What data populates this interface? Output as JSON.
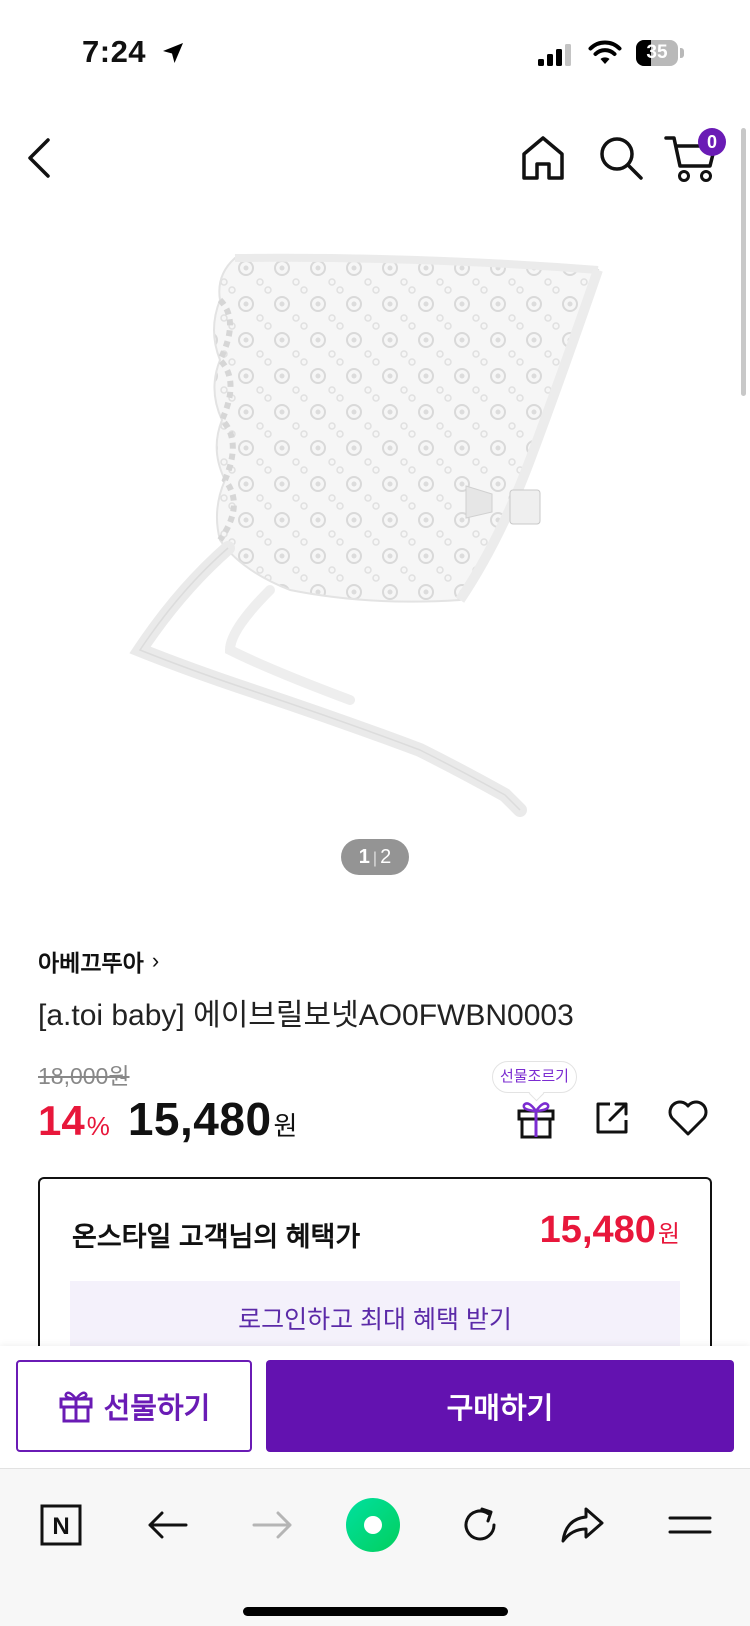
{
  "status_bar": {
    "time": "7:24",
    "battery_level": "35",
    "battery_fraction": 0.35
  },
  "header": {
    "cart_count": "0"
  },
  "product": {
    "page_current": "1",
    "page_total": "2",
    "brand": "아베끄뚜아",
    "brand_chevron": "›",
    "name": "[a.toi baby] 에이브릴보넷AO0FWBN0003",
    "original_price": "18,000원",
    "discount": "14",
    "discount_unit": "%",
    "sale_price": "15,480",
    "sale_unit": "원",
    "gift_tooltip": "선물조르기"
  },
  "benefit": {
    "label": "온스타일 고객님의 혜택가",
    "price": "15,480",
    "price_unit": "원",
    "login_cta": "로그인하고 최대 혜택 받기"
  },
  "actions": {
    "gift_label": "선물하기",
    "buy_label": "구매하기"
  },
  "browser": {
    "n_label": "N"
  },
  "colors": {
    "brand_purple": "#6312b0",
    "sale_red": "#e8173b",
    "benefit_bg": "#f4f1fb",
    "naver_green": "#03cf5d"
  },
  "icons": {
    "back": "chevron-left-icon",
    "home": "home-icon",
    "search": "search-icon",
    "cart": "cart-icon",
    "gift": "gift-icon",
    "share": "share-icon",
    "heart": "heart-icon"
  }
}
